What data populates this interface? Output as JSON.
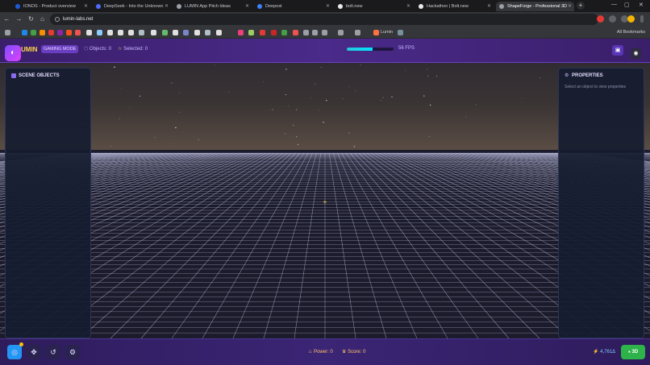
{
  "browser": {
    "tabs": [
      {
        "title": "IONOS - Product overview",
        "color": "#1e5bd8"
      },
      {
        "title": "DeepSeek - Into the Unknown",
        "color": "#4d6bfe"
      },
      {
        "title": "LUMIN App Pitch Ideas",
        "color": "#9aa0a6"
      },
      {
        "title": "Deepost",
        "color": "#3b82f6"
      },
      {
        "title": "bolt.new",
        "color": "#e8eaed"
      },
      {
        "title": "Hackathon | Bolt.new",
        "color": "#e8eaed"
      },
      {
        "title": "ShapeForge - Professional 3D",
        "color": "#9aa0a6"
      }
    ],
    "url": "lumin-labs.net",
    "bookmarks": {
      "lumin": "Lumin",
      "all": "All Bookmarks"
    }
  },
  "header": {
    "logo_icon": "palette-icon",
    "brand": "UMIN",
    "mode": "GAMING MODE",
    "objects": "Objects: 0",
    "selected": "Selected: 0",
    "fps_progress": 0.55,
    "fps": "56 FPS"
  },
  "left_panel": {
    "title": "SCENE OBJECTS"
  },
  "right_panel": {
    "title": "PROPERTIES",
    "hint": "Select an object to view properties"
  },
  "footer": {
    "power": "Power: 0",
    "score": "Score: 0",
    "credits": "4,761",
    "mode_button": "3D"
  },
  "colors": {
    "accent": "#6b3fc4",
    "brand": "#ffd54a",
    "go": "#2db34a"
  }
}
